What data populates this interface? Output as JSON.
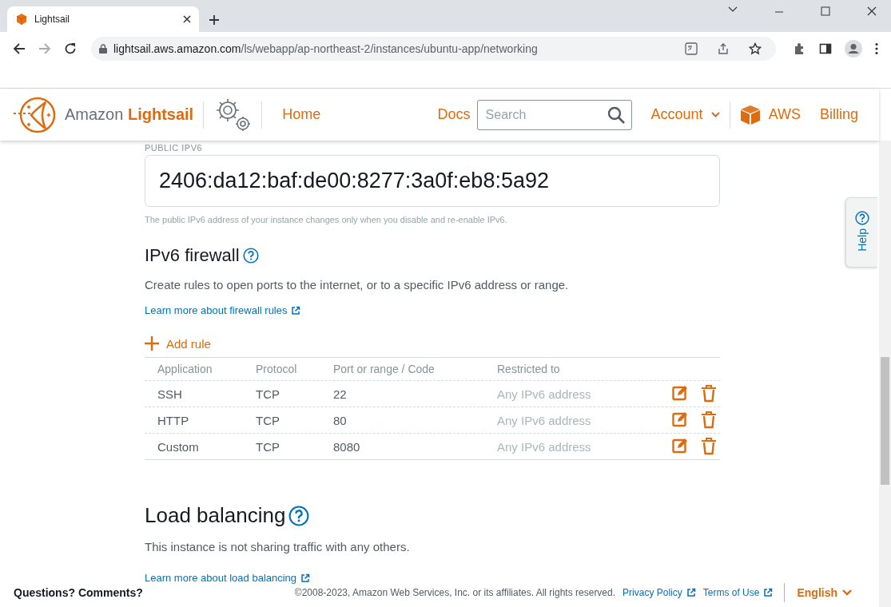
{
  "browser": {
    "tab_title": "Lightsail",
    "address": {
      "host": "lightsail.aws.amazon.com",
      "path": "/ls/webapp/ap-northeast-2/instances/ubuntu-app/networking"
    }
  },
  "header": {
    "brand": {
      "first": "Amazon",
      "second": "Lightsail"
    },
    "nav": [
      "Home"
    ],
    "docs": "Docs",
    "search": {
      "placeholder": "Search"
    },
    "account": "Account",
    "aws": "AWS",
    "billing": "Billing"
  },
  "ipv6": {
    "label": "PUBLIC IPV6",
    "address": "2406:da12:baf:de00:8277:3a0f:eb8:5a92",
    "hint": "The public IPv6 address of your instance changes only when you disable and re-enable IPv6."
  },
  "firewall": {
    "title": "IPv6 firewall",
    "description": "Create rules to open ports to the internet, or to a specific IPv6 address or range.",
    "learn_more": "Learn more about firewall rules",
    "add_rule": "Add rule",
    "columns": [
      "Application",
      "Protocol",
      "Port or range / Code",
      "Restricted to"
    ],
    "rows": [
      [
        "SSH",
        "TCP",
        "22",
        "Any IPv6 address"
      ],
      [
        "HTTP",
        "TCP",
        "80",
        "Any IPv6 address"
      ],
      [
        "Custom",
        "TCP",
        "8080",
        "Any IPv6 address"
      ]
    ]
  },
  "load_balancing": {
    "title": "Load balancing",
    "description": "This instance is not sharing traffic with any others.",
    "learn_more": "Learn more about load balancing"
  },
  "help_tab": "Help",
  "footer": {
    "feedback": "Questions? Comments?",
    "copyright": "©2008-2023, Amazon Web Services, Inc. or its affiliates. All rights reserved.",
    "links": [
      "Privacy Policy",
      "Terms of Use"
    ],
    "language": "English"
  }
}
